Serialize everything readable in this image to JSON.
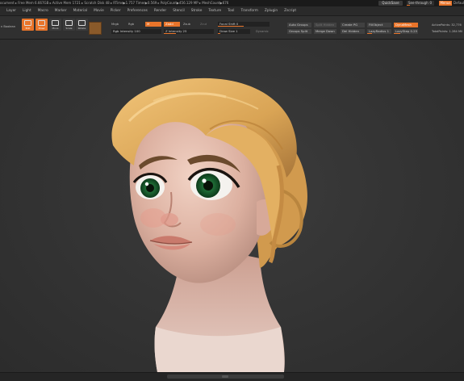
{
  "topbar": {
    "status_text": "ocument ▸ Free Mem 6.667GB ▸ Active Mem 1721 ▸ Scratch Disk 48 ▸ RTime▶1.757 Timer▶0.569 ▸ PolyCount▶456.129 MP ▸ MeshCount▶676",
    "quicksave": "QuickSave",
    "see_through": "See-through",
    "see_through_value": "0",
    "menus": "Menus",
    "default": "Defaul",
    "accent_color": "#e8742a"
  },
  "menubar": {
    "items": [
      "",
      "Layer",
      "Light",
      "Macro",
      "Marker",
      "Material",
      "Movie",
      "Picker",
      "Preferences",
      "Render",
      "Stencil",
      "Stroke",
      "Texture",
      "Tool",
      "Transform",
      "Zplugin",
      "Zscript"
    ]
  },
  "toolbar": {
    "left_label": "n Boolean",
    "tools": [
      {
        "label": "Edit",
        "active": true
      },
      {
        "label": "Draw",
        "active": true
      },
      {
        "label": "Move",
        "active": false
      },
      {
        "label": "Scale",
        "active": false
      },
      {
        "label": "Rotate",
        "active": false
      }
    ],
    "mrgb": "Mrgb",
    "rgb": "Rgb",
    "m": "M",
    "zadd": "Zadd",
    "zsub": "Zsub",
    "zcut": "Zcut",
    "rgb_intensity": "Rgb Intensity 100",
    "z_intensity": "Z Intensity 25",
    "focal_shift": "Focal Shift 0",
    "draw_size": "Draw Size 1",
    "dynamic": "Dynamic",
    "auto_groups": "Auto Groups",
    "split_hidden": "Split Hidden",
    "groups_split": "Groups Split",
    "merge_down": "Merge Down",
    "create_pg": "Create PG",
    "del_hidden": "Del Hidden",
    "fill_object": "FillObject",
    "un_crease_all": "UnCreaseAll",
    "zremesher": "ZRemesher",
    "dynamesh": "DynaMesh",
    "poly_f": "PolyF",
    "lazy_radius": "LazyRadius 1",
    "lazy_step": "LazyStep 0.25",
    "active_points": "ActivePoints: 32,776",
    "total_points": "TotalPoints: 1.284 Mil"
  },
  "viewport": {
    "subject": "3D sculpt of a stylized female bust with blonde hair"
  }
}
